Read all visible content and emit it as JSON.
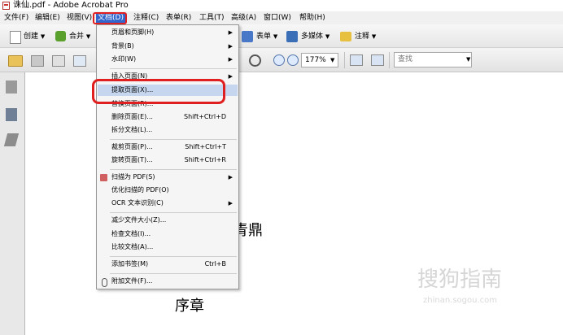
{
  "window": {
    "title": "诛仙.pdf - Adobe Acrobat Pro"
  },
  "menubar": {
    "items": [
      {
        "label": "文件(F)"
      },
      {
        "label": "编辑(E)"
      },
      {
        "label": "视图(V)"
      },
      {
        "label": "文档(D)"
      },
      {
        "label": "注释(C)"
      },
      {
        "label": "表单(R)"
      },
      {
        "label": "工具(T)"
      },
      {
        "label": "高级(A)"
      },
      {
        "label": "窗口(W)"
      },
      {
        "label": "帮助(H)"
      }
    ]
  },
  "toolbar1": {
    "create_label": "创建",
    "combine_label": "合并",
    "forms_label": "表单",
    "multimedia_label": "多媒体",
    "comment_label": "注释"
  },
  "toolbar2": {
    "zoom_value": "177%",
    "search_placeholder": "查找"
  },
  "document_menu": {
    "items": [
      {
        "label": "页眉和页脚(H)",
        "submenu": true
      },
      {
        "label": "背景(B)",
        "submenu": true
      },
      {
        "label": "水印(W)",
        "submenu": true
      },
      {
        "label": "插入页面(N)",
        "submenu": true
      },
      {
        "label": "提取页面(X)...",
        "highlighted": true
      },
      {
        "label": "替换页面(R)..."
      },
      {
        "label": "删除页面(E)...",
        "shortcut": "Shift+Ctrl+D"
      },
      {
        "label": "拆分文档(L)..."
      },
      {
        "label": "裁剪页面(P)...",
        "shortcut": "Shift+Ctrl+T"
      },
      {
        "label": "旋转页面(T)...",
        "shortcut": "Shift+Ctrl+R"
      },
      {
        "label": "扫描为 PDF(S)",
        "submenu": true,
        "icon": "scanner-icon"
      },
      {
        "label": "优化扫描的 PDF(O)"
      },
      {
        "label": "OCR 文本识别(C)",
        "submenu": true
      },
      {
        "label": "减少文件大小(Z)..."
      },
      {
        "label": "检查文档(I)..."
      },
      {
        "label": "比较文档(A)..."
      },
      {
        "label": "添加书签(M)",
        "shortcut": "Ctrl+B"
      },
      {
        "label": "附加文件(F)...",
        "icon": "paperclip-icon"
      }
    ]
  },
  "document": {
    "visible_text_1": "青鼎",
    "visible_text_2": "序章"
  },
  "watermark": {
    "main": "搜狗指南",
    "sub": "zhinan.sogou.com"
  },
  "colors": {
    "highlight_red": "#e02020",
    "menu_active": "#3366cc",
    "menu_hover": "#c6d6ee"
  }
}
